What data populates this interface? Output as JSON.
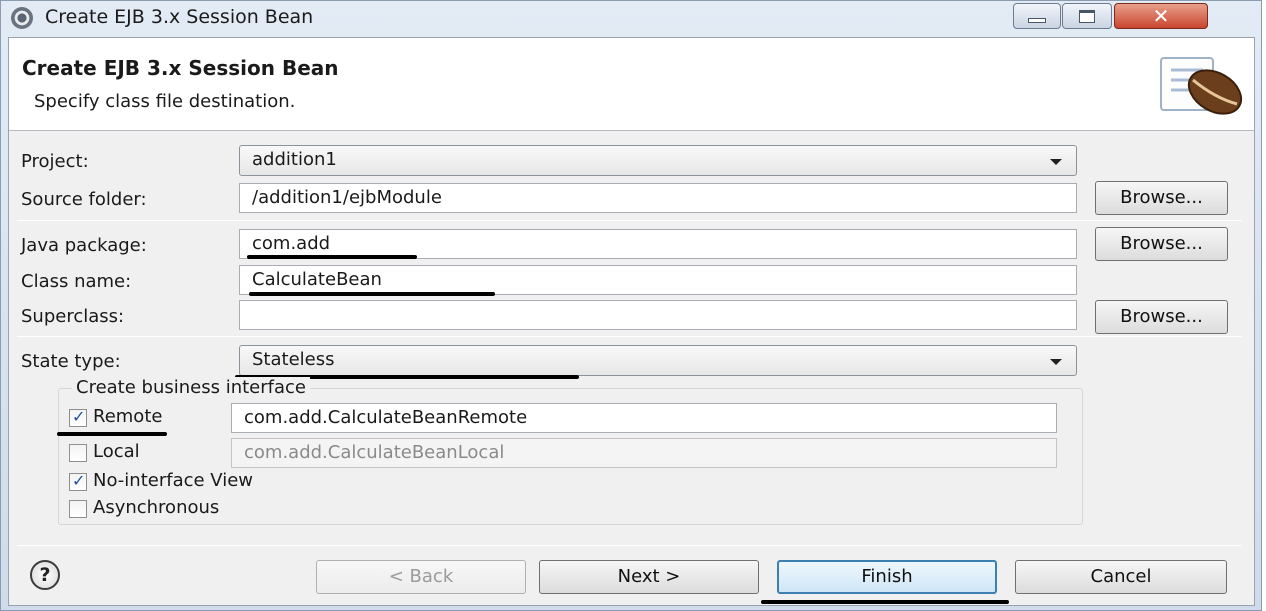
{
  "window": {
    "title": "Create EJB 3.x Session Bean"
  },
  "header": {
    "title": "Create EJB 3.x Session Bean",
    "subtitle": "Specify class file destination."
  },
  "form": {
    "project_label": "Project:",
    "project_value": "addition1",
    "source_folder_label": "Source folder:",
    "source_folder_value": "/addition1/ejbModule",
    "java_package_label": "Java package:",
    "java_package_value": "com.add",
    "class_name_label": "Class name:",
    "class_name_value": "CalculateBean",
    "superclass_label": "Superclass:",
    "superclass_value": "",
    "state_type_label": "State type:",
    "state_type_value": "Stateless",
    "browse_label": "Browse..."
  },
  "business_interface": {
    "group_label": "Create business interface",
    "remote_label": "Remote",
    "remote_checked": true,
    "remote_value": "com.add.CalculateBeanRemote",
    "local_label": "Local",
    "local_checked": false,
    "local_value": "com.add.CalculateBeanLocal",
    "no_interface_label": "No-interface View",
    "no_interface_checked": true,
    "asynchronous_label": "Asynchronous",
    "asynchronous_checked": false
  },
  "footer": {
    "help_glyph": "?",
    "back_label": "< Back",
    "next_label": "Next >",
    "finish_label": "Finish",
    "cancel_label": "Cancel"
  },
  "colors": {
    "underline": "#000000",
    "default_button_border": "#3c7fb1",
    "check_color": "#1d4f9e"
  }
}
